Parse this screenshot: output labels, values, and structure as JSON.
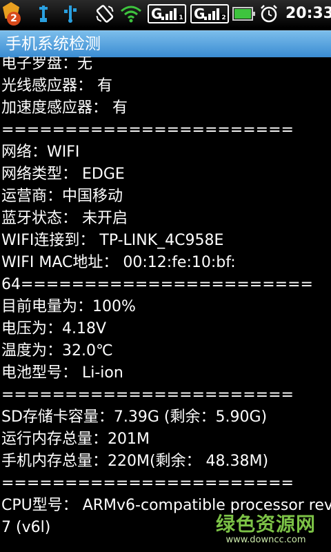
{
  "status_bar": {
    "notification_count": "2",
    "signal1_label": "G",
    "signal1_sim": "1",
    "signal2_label": "G",
    "signal2_sim": "2",
    "battery_level": 1.0,
    "time": "20:33",
    "colors": {
      "battery": "#3ec43e",
      "usb": "#2aa0e0",
      "wifi": "#3ec43e",
      "badge": "#d84a1b"
    }
  },
  "title_bar": {
    "title": "手机系统检测"
  },
  "info_lines": [
    "电子罗盘：无",
    "光线感应器： 有",
    "加速度感应器： 有",
    "=======================",
    "网络：WIFI",
    "网络类型： EDGE",
    "运营商：中国移动",
    "蓝牙状态： 未开启",
    "WIFI连接到： TP-LINK_4C958E",
    "WIFI MAC地址： 00:12:fe:10:bf:",
    "64=======================",
    "目前电量为：100%",
    "电压为：4.18V",
    "温度为：32.0℃",
    "电池型号： Li-ion",
    "=======================",
    "SD存储卡容量：7.39G (剩余：5.90G)",
    "运行内存总量：201M",
    "手机内存总量：220M(剩余： 48.38M)",
    "=======================",
    "CPU型号： ARMv6-compatible processor rev",
    "7 (v6l)"
  ],
  "watermark": {
    "main": "绿色资源网",
    "url": "www.downcc.com"
  }
}
